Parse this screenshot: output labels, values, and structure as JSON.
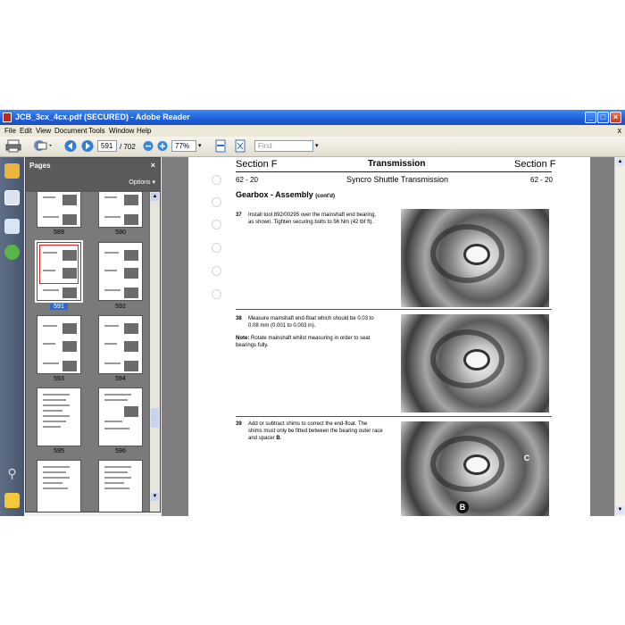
{
  "window": {
    "title": "JCB_3cx_4cx.pdf (SECURED) - Adobe Reader"
  },
  "menu": [
    "File",
    "Edit",
    "View",
    "Document",
    "Tools",
    "Window",
    "Help"
  ],
  "menu_close": "x",
  "toolbar": {
    "page_current": "591",
    "page_total": "/ 702",
    "zoom": "77%",
    "find_placeholder": "Find"
  },
  "pages_panel": {
    "title": "Pages",
    "options": "Options",
    "close": "×",
    "thumbnails": [
      "589",
      "590",
      "591",
      "592",
      "593",
      "594",
      "595",
      "596"
    ],
    "selected": "591"
  },
  "document": {
    "header_left": "Section F",
    "header_center": "Transmission",
    "header_right": "Section F",
    "sub_left": "62 - 20",
    "sub_center": "Syncro Shuttle Transmission",
    "sub_right": "62 - 20",
    "heading": "Gearbox - Assembly",
    "heading_suffix": "(cont'd)",
    "steps": [
      {
        "num": "37",
        "line1": "Install tool 892/00295 over the mainshaft end bearing,",
        "line2": "as shown. Tighten securing bolts to 56 Nm (42 lbf ft)."
      },
      {
        "num": "38",
        "line1": "Measure mainshaft end-float which should be 0.03 to",
        "line2": "0.08 mm (0.001 to 0.003 in)."
      },
      {
        "num": "39",
        "line1": "Add or subtract shims to correct the end-float. The",
        "line2": "shims must only be fitted between the bearing outer race",
        "line3_prefix": "and spacer ",
        "line3_bold": "B",
        "line3_suffix": "."
      }
    ],
    "note_label": "Note:",
    "note_line1": "Rotate mainshaft whilst measuring in order to seat",
    "note_line2": "bearings fully.",
    "callout_b": "B",
    "callout_c": "C"
  }
}
